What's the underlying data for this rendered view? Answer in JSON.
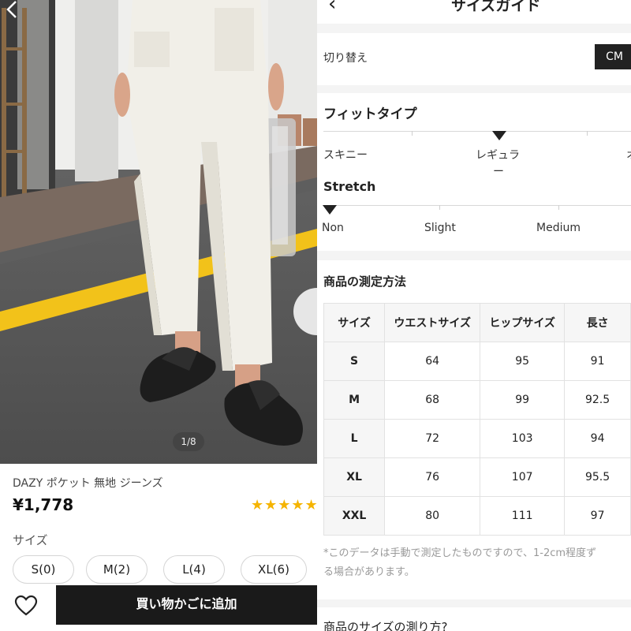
{
  "product": {
    "image_counter": "1/8",
    "title": "DAZY ポケット 無地 ジーンズ",
    "price": "¥1,778",
    "rating_stars": "★★★★★",
    "size_label": "サイズ",
    "sizes": [
      "S(0)",
      "M(2)",
      "L(4)",
      "XL(6)"
    ],
    "add_to_cart": "買い物かごに追加"
  },
  "size_guide": {
    "title": "サイズガイド",
    "switch_label": "切り替え",
    "unit_button": "CM",
    "fit_title": "フィットタイプ",
    "fit_labels": [
      "スキニー",
      "レギュラ",
      "オ"
    ],
    "fit_selected": "レギュラ",
    "fit_dash": "ー",
    "stretch_title": "Stretch",
    "stretch_labels": [
      "Non",
      "Slight",
      "Medium"
    ],
    "stretch_selected": "Non",
    "measure_title": "商品の測定方法",
    "table": {
      "headers": [
        "サイズ",
        "ウエストサイズ",
        "ヒップサイズ",
        "長さ"
      ],
      "rows": [
        [
          "S",
          "64",
          "95",
          "91"
        ],
        [
          "M",
          "68",
          "99",
          "92.5"
        ],
        [
          "L",
          "72",
          "103",
          "94"
        ],
        [
          "XL",
          "76",
          "107",
          "95.5"
        ],
        [
          "XXL",
          "80",
          "111",
          "97"
        ]
      ]
    },
    "note_line1": "*このデータは手動で測定したものですので、1-2cm程度ず",
    "note_line2": "る場合があります。",
    "how_to_title": "商品のサイズの測り方?"
  },
  "colors": {
    "star": "#f5b400",
    "button_dark": "#1a1a1a",
    "road_line": "#f2c21a"
  }
}
